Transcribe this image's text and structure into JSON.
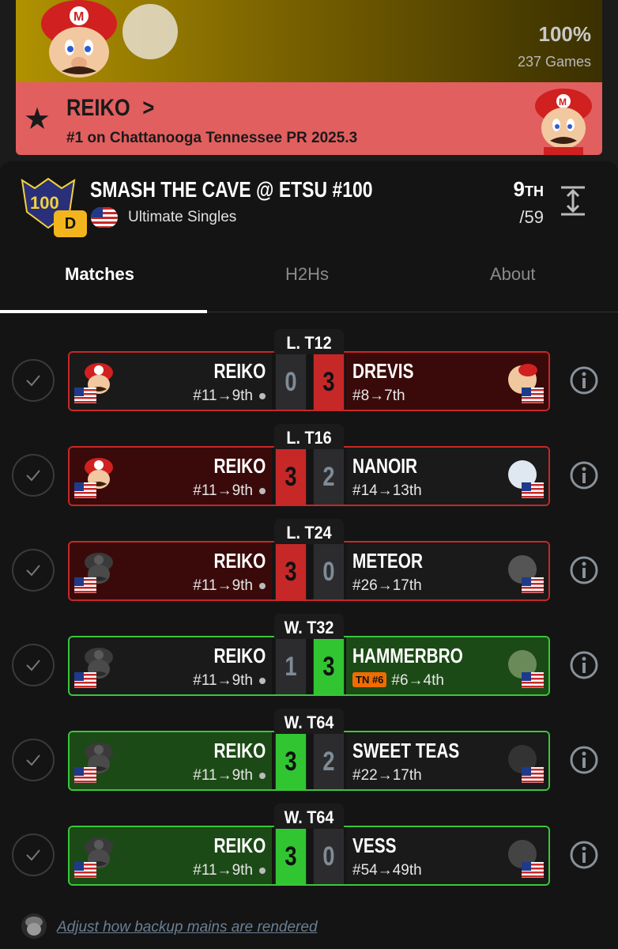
{
  "banner": {
    "percent": "100%",
    "games": "237 Games"
  },
  "player": {
    "name": "REIKO",
    "chevron": ">",
    "rank": "#1 on Chattanooga Tennessee PR 2025.3"
  },
  "event": {
    "title": "SMASH THE CAVE @ ETSU #100",
    "tier": "D",
    "type": "Ultimate Singles",
    "placing": "9",
    "placing_suffix": "TH",
    "entrants": "/59"
  },
  "tabs": [
    "Matches",
    "H2Hs",
    "About"
  ],
  "colors": {
    "loss_red": "#c62828",
    "win_green": "#31c531",
    "banner_red": "#e25f5f",
    "pr_badge": "#ef6c00"
  },
  "matches": [
    {
      "round": "L. T12",
      "p1": "REIKO",
      "p1_seed": "#11→9th",
      "p1_score": "0",
      "p2_score": "3",
      "p2": "DREVIS",
      "p2_seed": "#8→7th",
      "p2_badge": "",
      "result": "loss",
      "p1_char_icon": "mario-icon",
      "p2_char_icon": "diddy-kong-icon"
    },
    {
      "round": "L. T16",
      "p1": "REIKO",
      "p1_seed": "#11→9th",
      "p1_score": "3",
      "p2_score": "2",
      "p2": "NANOIR",
      "p2_seed": "#14→13th",
      "p2_badge": "",
      "result": "win-red",
      "p1_char_icon": "mario-icon",
      "p2_char_icon": "pyra-icon"
    },
    {
      "round": "L. T24",
      "p1": "REIKO",
      "p1_seed": "#11→9th",
      "p1_score": "3",
      "p2_score": "0",
      "p2": "METEOR",
      "p2_seed": "#26→17th",
      "p2_badge": "",
      "result": "win-red",
      "p1_char_icon": "mario-icon",
      "p2_char_icon": "olimar-icon"
    },
    {
      "round": "W. T32",
      "p1": "REIKO",
      "p1_seed": "#11→9th",
      "p1_score": "1",
      "p2_score": "3",
      "p2": "HAMMERBRO",
      "p2_seed": "#6→4th",
      "p2_badge": "TN #6",
      "result": "loss-green",
      "p1_char_icon": "mario-icon",
      "p2_char_icon": "steve-icon"
    },
    {
      "round": "W. T64",
      "p1": "REIKO",
      "p1_seed": "#11→9th",
      "p1_score": "3",
      "p2_score": "2",
      "p2": "SWEET TEAS",
      "p2_seed": "#22→17th",
      "p2_badge": "",
      "result": "win-green",
      "p1_char_icon": "mario-icon",
      "p2_char_icon": "king-k-rool-icon"
    },
    {
      "round": "W. T64",
      "p1": "REIKO",
      "p1_seed": "#11→9th",
      "p1_score": "3",
      "p2_score": "0",
      "p2": "VESS",
      "p2_seed": "#54→49th",
      "p2_badge": "",
      "result": "win-green",
      "p1_char_icon": "mario-icon",
      "p2_char_icon": "sephiroth-icon"
    }
  ],
  "footer": {
    "link": "Adjust how backup mains are rendered"
  }
}
